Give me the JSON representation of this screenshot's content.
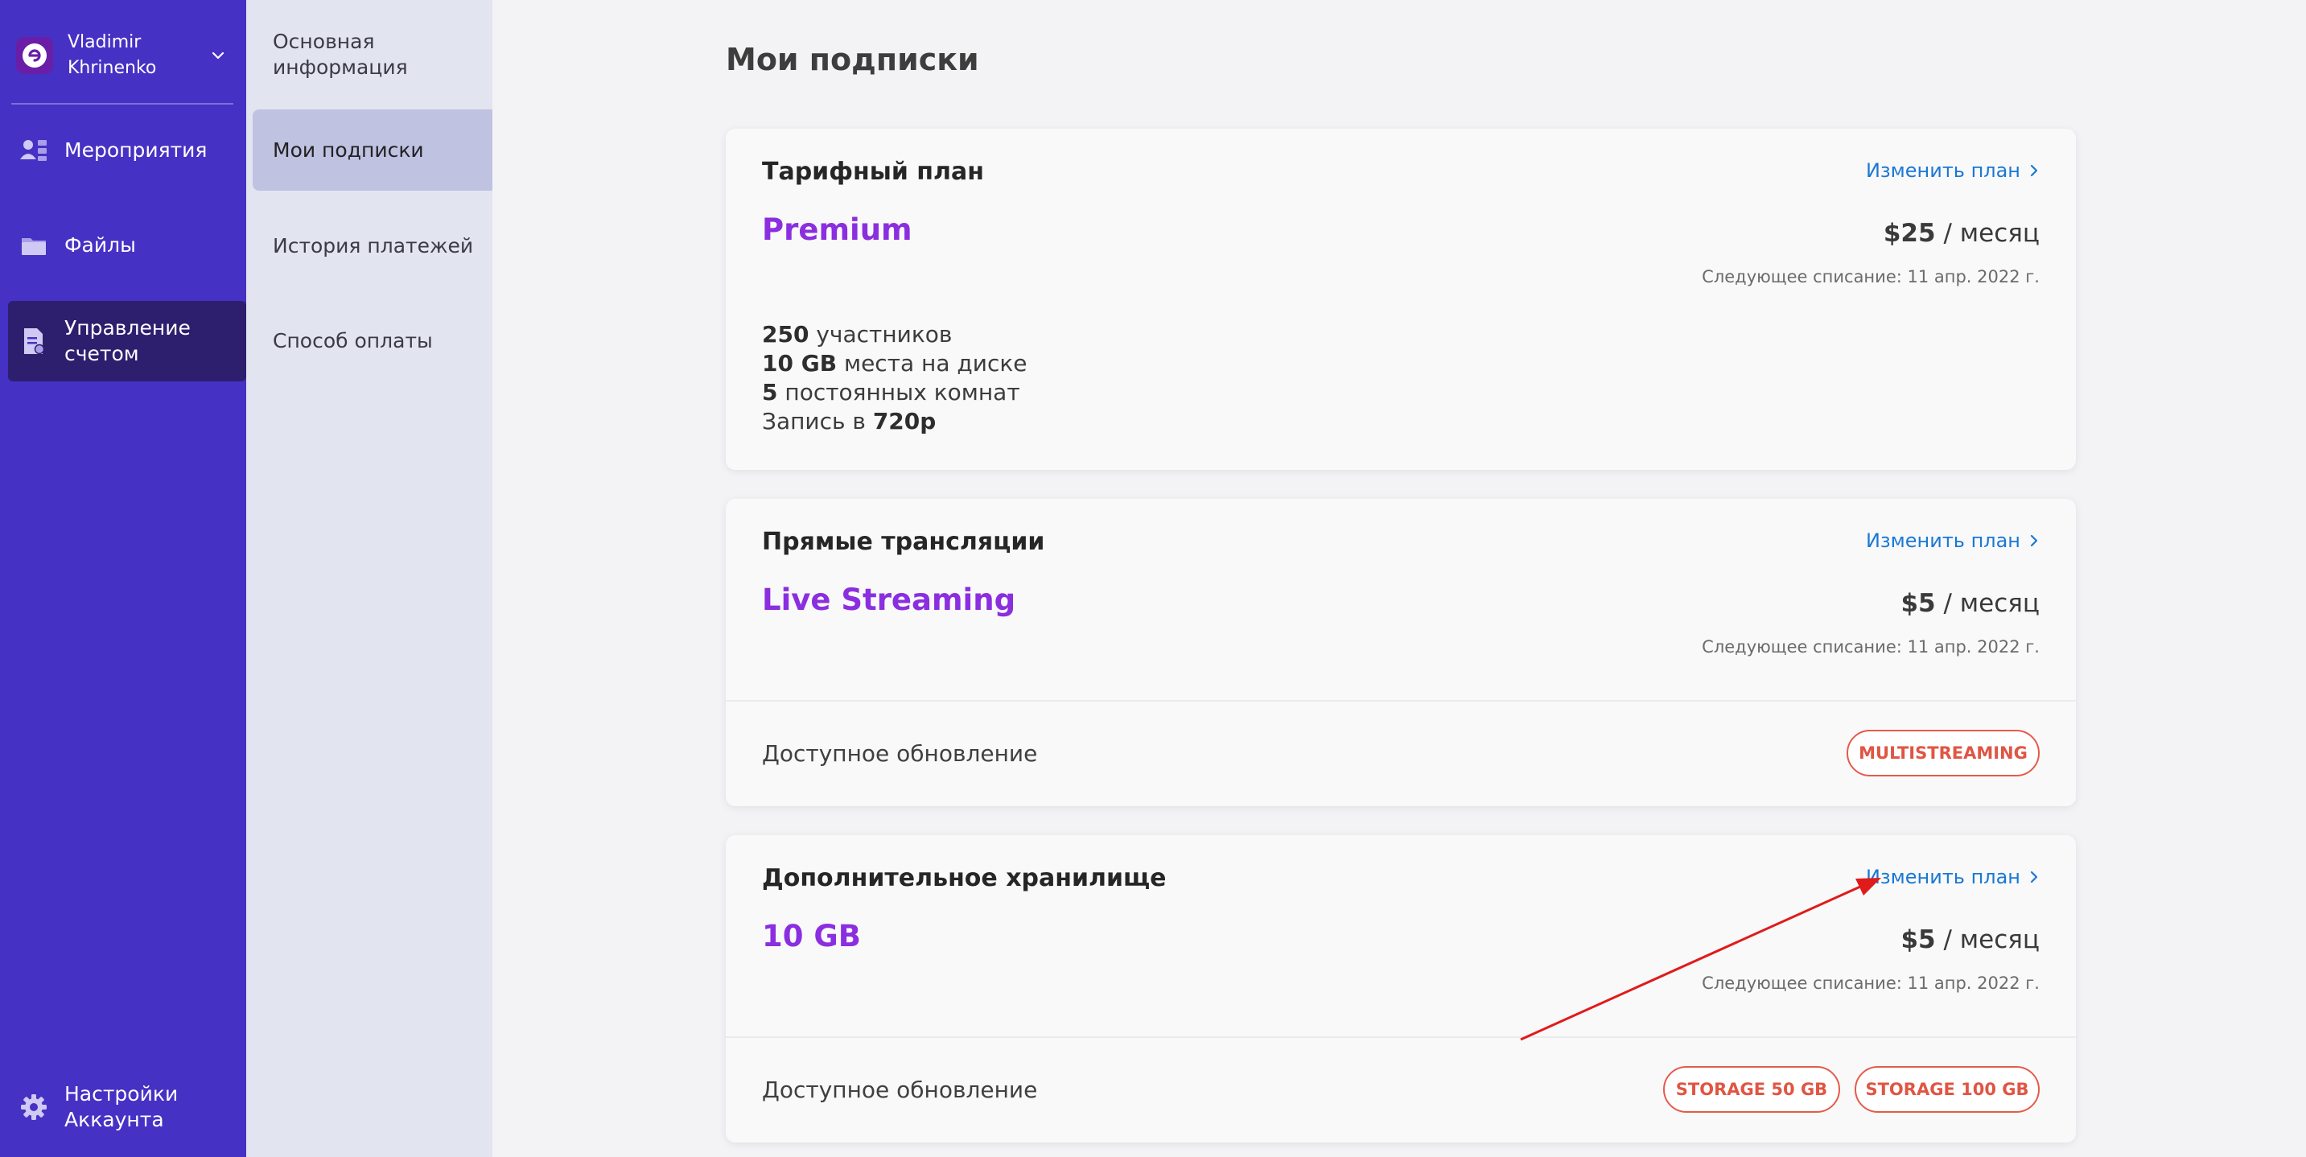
{
  "user": {
    "first_name": "Vladimir",
    "last_name": "Khrinenko"
  },
  "sidebar": {
    "items": [
      {
        "label": "Мероприятия",
        "icon": "people-icon"
      },
      {
        "label": "Файлы",
        "icon": "folder-icon"
      },
      {
        "label": "Управление счетом",
        "icon": "document-icon",
        "active": true
      }
    ],
    "footer": {
      "label": "Настройки Аккаунта",
      "icon": "gear-icon"
    }
  },
  "subnav": {
    "items": [
      {
        "label": "Основная информация"
      },
      {
        "label": "Мои подписки",
        "active": true
      },
      {
        "label": "История платежей"
      },
      {
        "label": "Способ оплаты"
      }
    ]
  },
  "page": {
    "title": "Мои подписки"
  },
  "cards": {
    "tariff": {
      "title": "Тарифный план",
      "link": "Изменить план",
      "plan_name": "Premium",
      "price": "$25",
      "period": "/ месяц",
      "next_charge": "Следующее списание: 11 апр. 2022 г.",
      "features": [
        {
          "bold": "250",
          "text": " участников"
        },
        {
          "bold": "10 GB",
          "text": " места на диске"
        },
        {
          "bold": "5",
          "text": " постоянных комнат"
        },
        {
          "prefix": "Запись в ",
          "bold": "720p"
        }
      ]
    },
    "streaming": {
      "title": "Прямые трансляции",
      "link": "Изменить план",
      "plan_name": "Live Streaming",
      "price": "$5",
      "period": "/ месяц",
      "next_charge": "Следующее списание: 11 апр. 2022 г.",
      "upgrade_label": "Доступное обновление",
      "upgrades": [
        "MULTISTREAMING"
      ]
    },
    "storage": {
      "title": "Дополнительное хранилище",
      "link": "Изменить план",
      "plan_name": "10 GB",
      "price": "$5",
      "period": "/ месяц",
      "next_charge": "Следующее списание: 11 апр. 2022 г.",
      "upgrade_label": "Доступное обновление",
      "upgrades": [
        "STORAGE 50 GB",
        "STORAGE 100 GB"
      ]
    }
  },
  "colors": {
    "sidebar_bg": "#4531c4",
    "sidebar_active": "#2d1f6e",
    "subnav_bg": "#e2e4f0",
    "plan_accent": "#8b2ee0",
    "link": "#1a78d6",
    "pill": "#e05543",
    "annotation_arrow": "#e01b1b"
  }
}
